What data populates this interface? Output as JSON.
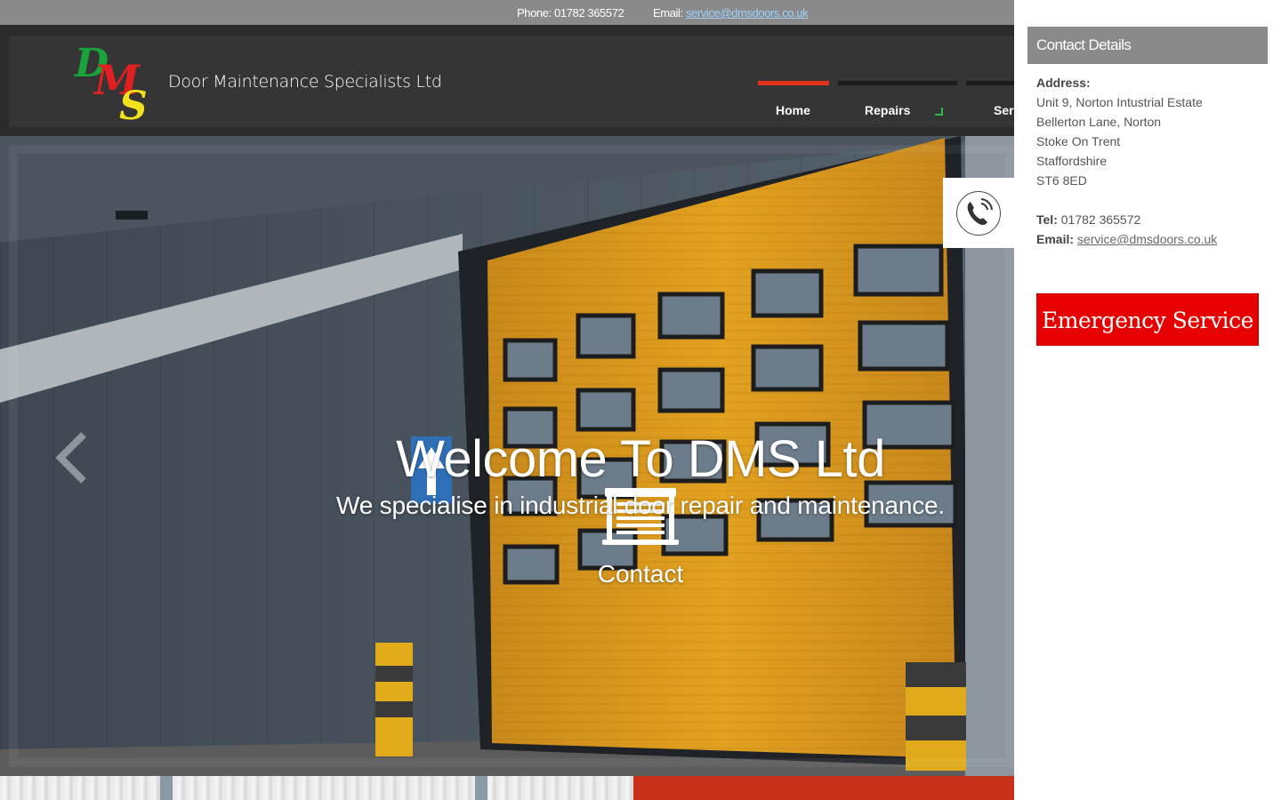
{
  "topbar": {
    "phone": "Phone: 01782 365572",
    "email_label": "Email:",
    "email": "service@dmsdoors.co.uk"
  },
  "header": {
    "logo_letters": [
      "D",
      "M",
      "S"
    ],
    "company_name": "Door Maintenance Specialists Ltd",
    "nav": [
      {
        "label": "Home"
      },
      {
        "label": "Repairs"
      },
      {
        "label": "Ser"
      }
    ]
  },
  "hero": {
    "icon": "roller-door-icon",
    "title": "Welcome To DMS Ltd",
    "subtitle": "We specialise in industrial door repair and maintenance.",
    "cta": "Contact"
  },
  "call_tab": {
    "icon": "phone-icon"
  },
  "side_panel": {
    "title": "Contact Details",
    "address_label": "Address:",
    "address_lines": [
      "Unit 9, Norton Intustrial Estate",
      "Bellerton Lane, Norton",
      "Stoke On Trent",
      "Staffordshire",
      "ST6 8ED"
    ],
    "tel_label": "Tel:",
    "tel": "01782 365572",
    "email_label": "Email:",
    "email": "service@dmsdoors.co.uk",
    "emergency_button": "Emergency Service"
  },
  "colors": {
    "accent_red": "#e3321c",
    "emergency_red": "#e60000",
    "door_yellow": "#e8a51c",
    "caret_green": "#2dbb4a"
  }
}
